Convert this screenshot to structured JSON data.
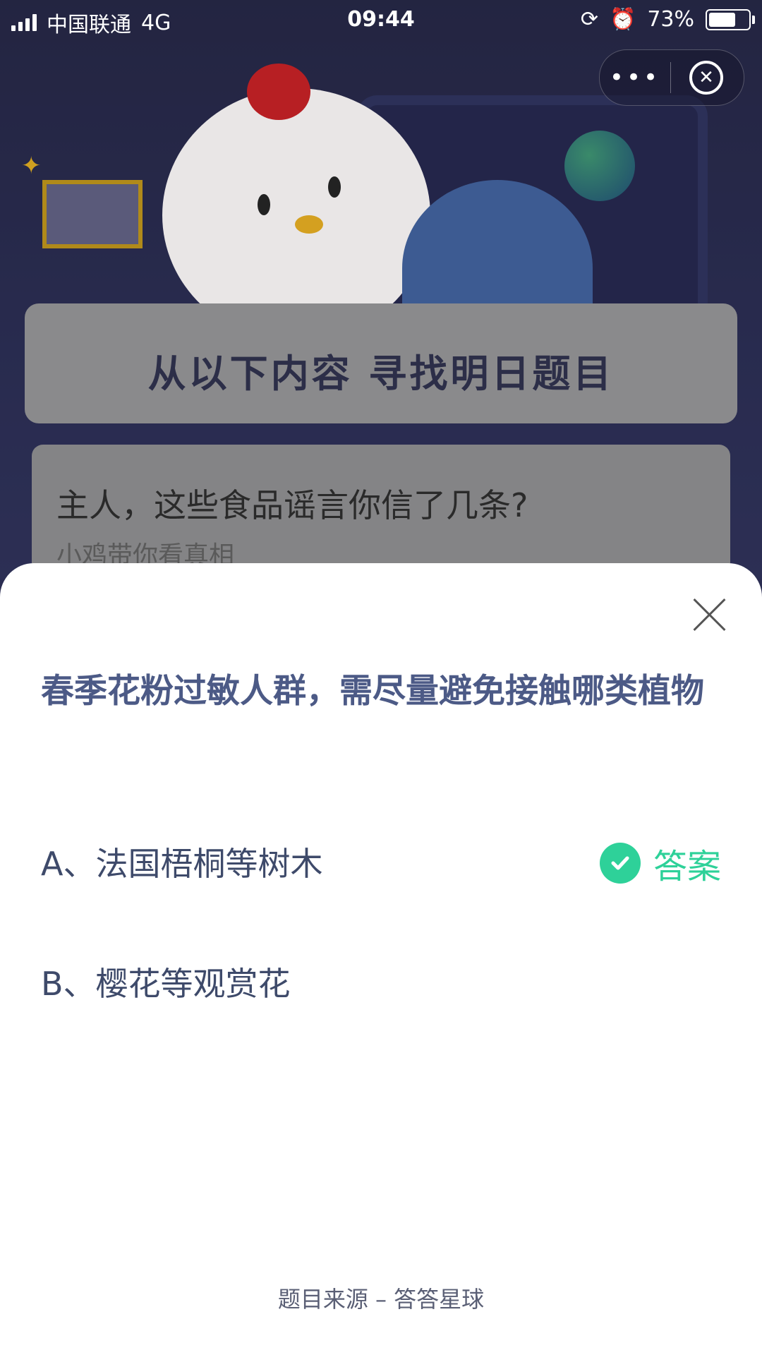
{
  "status_bar": {
    "carrier": "中国联通",
    "network": "4G",
    "time": "09:44",
    "battery": "73%",
    "battery_level": 0.73
  },
  "capsule": {
    "more_label": "•••",
    "close_label": "✕"
  },
  "background": {
    "banner_title": "从以下内容 寻找明日题目",
    "card_title": "主人，这些食品谣言你信了几条?",
    "card_subtitle": "小鸡带你看真相"
  },
  "quiz": {
    "question": "春季花粉过敏人群，需尽量避免接触哪类植物",
    "options": [
      {
        "label": "A、法国梧桐等树木"
      },
      {
        "label": "B、樱花等观赏花"
      }
    ],
    "answer_badge": "答案",
    "source": "题目来源 – 答答星球"
  },
  "colors": {
    "accent_green": "#2ed199",
    "question_text": "#4c5a86"
  }
}
